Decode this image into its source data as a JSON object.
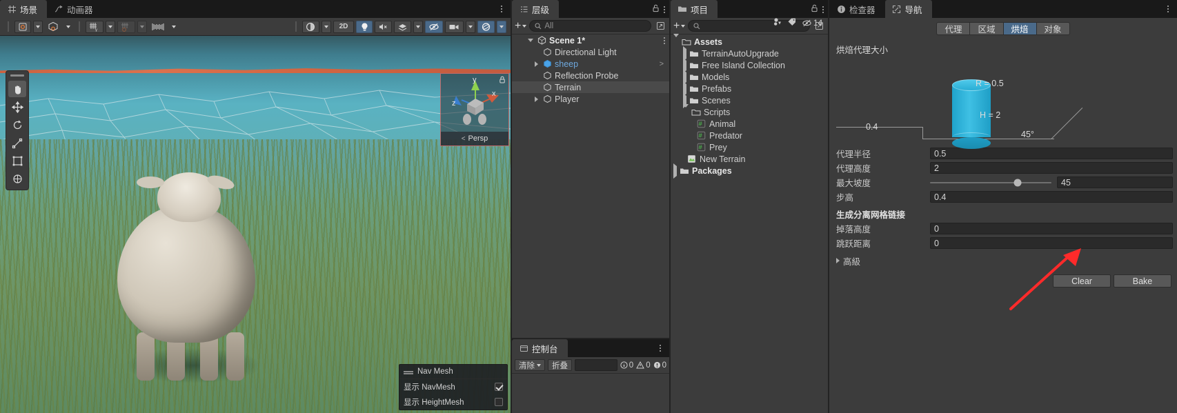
{
  "scene": {
    "tabs": [
      {
        "label": "场景",
        "icon": "grid-icon",
        "active": true
      },
      {
        "label": "动画器",
        "icon": "animator-icon",
        "active": false
      }
    ],
    "toolbar": {
      "left_groups": [
        {
          "name": "pivot-rotation",
          "label": "",
          "icon": "pivot-icon",
          "has_caret": true
        },
        {
          "name": "pivot-center",
          "label": "",
          "icon": "cube-icon",
          "has_caret": true
        },
        {
          "name": "grid-snap",
          "label": "",
          "icon": "grid-snap-icon",
          "has_caret": true
        },
        {
          "name": "vertex-snap",
          "label": "",
          "icon": "vertex-snap-icon",
          "has_caret": true
        },
        {
          "name": "ruler",
          "label": "",
          "icon": "ruler-icon",
          "has_caret": true
        }
      ],
      "right_groups": [
        {
          "name": "shading-mode",
          "label": "",
          "icon": "shading-sphere-icon",
          "has_caret": true
        },
        {
          "name": "2d-toggle",
          "label": "2D",
          "icon": "",
          "has_caret": false
        },
        {
          "name": "lighting-toggle",
          "label": "",
          "icon": "bulb-icon",
          "active": true
        },
        {
          "name": "audio-toggle",
          "label": "",
          "icon": "speaker-mute-icon"
        },
        {
          "name": "effects-toggle",
          "label": "",
          "icon": "fx-icon",
          "has_caret": true
        },
        {
          "name": "visibility-toggle",
          "label": "",
          "icon": "eye-slash-icon",
          "active": true
        },
        {
          "name": "camera-settings",
          "label": "",
          "icon": "camera-icon",
          "has_caret": true
        },
        {
          "name": "gizmos-toggle",
          "label": "",
          "icon": "gizmo-icon",
          "active": true,
          "has_caret": true
        }
      ]
    },
    "tools": [
      {
        "name": "hand-tool",
        "icon": "hand-icon",
        "active": true
      },
      {
        "name": "move-tool",
        "icon": "move-icon",
        "active": false
      },
      {
        "name": "rotate-tool",
        "icon": "rotate-icon",
        "active": false
      },
      {
        "name": "scale-tool",
        "icon": "scale-icon",
        "active": false
      },
      {
        "name": "rect-tool",
        "icon": "rect-icon",
        "active": false
      },
      {
        "name": "transform-tool",
        "icon": "transform-icon",
        "active": false
      }
    ],
    "gizmo": {
      "axis_y": "y",
      "axis_x": "x",
      "axis_z": "z",
      "projection": "Persp"
    },
    "overlay": {
      "title": "Nav Mesh",
      "rows": [
        {
          "label": "显示 NavMesh",
          "checked": true
        },
        {
          "label": "显示 HeightMesh",
          "checked": false
        }
      ]
    }
  },
  "hierarchy": {
    "tab": {
      "label": "层级",
      "icon": "hierarchy-icon"
    },
    "add_label": "+",
    "search_placeholder": "All",
    "items": [
      {
        "label": "Scene 1*",
        "indent": 0,
        "expanded": true,
        "icon": "scene-icon",
        "bold": true,
        "kebab": true
      },
      {
        "label": "Directional Light",
        "indent": 1,
        "icon": "gameobject-icon"
      },
      {
        "label": "sheep",
        "indent": 1,
        "collapsed": true,
        "icon": "prefab-icon",
        "prefab": true,
        "chevron": true
      },
      {
        "label": "Reflection Probe",
        "indent": 1,
        "icon": "gameobject-icon"
      },
      {
        "label": "Terrain",
        "indent": 1,
        "icon": "gameobject-icon",
        "selected": true
      },
      {
        "label": "Player",
        "indent": 1,
        "collapsed": true,
        "icon": "gameobject-icon"
      }
    ]
  },
  "project": {
    "tab": {
      "label": "项目",
      "icon": "folder-icon"
    },
    "add_label": "+",
    "search_placeholder": "",
    "badge_count": "14",
    "items": [
      {
        "label": "Assets",
        "indent": 0,
        "expanded": true,
        "icon": "folder-open-icon",
        "bold": true
      },
      {
        "label": "TerrainAutoUpgrade",
        "indent": 1,
        "collapsed": true,
        "icon": "folder-icon"
      },
      {
        "label": "Free Island Collection",
        "indent": 1,
        "collapsed": true,
        "icon": "folder-icon"
      },
      {
        "label": "Models",
        "indent": 1,
        "collapsed": true,
        "icon": "folder-icon"
      },
      {
        "label": "Prefabs",
        "indent": 1,
        "collapsed": true,
        "icon": "folder-icon"
      },
      {
        "label": "Scenes",
        "indent": 1,
        "collapsed": true,
        "icon": "folder-icon"
      },
      {
        "label": "Scripts",
        "indent": 1,
        "expanded": true,
        "icon": "folder-open-icon"
      },
      {
        "label": "Animal",
        "indent": 2,
        "icon": "script-icon"
      },
      {
        "label": "Predator",
        "indent": 2,
        "icon": "script-icon"
      },
      {
        "label": "Prey",
        "indent": 2,
        "icon": "script-icon"
      },
      {
        "label": "New Terrain",
        "indent": 1,
        "icon": "terrain-asset-icon"
      },
      {
        "label": "Packages",
        "indent": 0,
        "collapsed": true,
        "icon": "folder-icon",
        "bold": true
      }
    ]
  },
  "inspector": {
    "tabs": [
      {
        "label": "检查器",
        "icon": "info-icon",
        "active": false
      },
      {
        "label": "导航",
        "icon": "navigation-icon",
        "active": true
      }
    ],
    "subtabs": [
      {
        "label": "代理",
        "active": false
      },
      {
        "label": "区域",
        "active": false
      },
      {
        "label": "烘焙",
        "active": true
      },
      {
        "label": "对象",
        "active": false
      }
    ],
    "navigation": {
      "section_title": "烘焙代理大小",
      "diagram": {
        "radius_label": "R = 0.5",
        "height_label": "H = 2",
        "step_label": "0.4",
        "slope_label": "45°"
      },
      "fields": [
        {
          "label": "代理半径",
          "value": "0.5",
          "type": "text"
        },
        {
          "label": "代理高度",
          "value": "2",
          "type": "text"
        },
        {
          "label": "最大坡度",
          "value": "45",
          "type": "slider",
          "slider_pct": 72
        },
        {
          "label": "步高",
          "value": "0.4",
          "type": "text"
        }
      ],
      "group_title": "生成分离网格链接",
      "group_fields": [
        {
          "label": "掉落高度",
          "value": "0",
          "type": "text"
        },
        {
          "label": "跳跃距离",
          "value": "0",
          "type": "text"
        }
      ],
      "foldout_label": "高級",
      "buttons": [
        {
          "label": "Clear",
          "name": "clear-button"
        },
        {
          "label": "Bake",
          "name": "bake-button"
        }
      ]
    }
  },
  "console": {
    "tab": {
      "label": "控制台",
      "icon": "console-icon"
    },
    "clear_label": "清除",
    "collapse_label": "折叠",
    "counters": [
      {
        "icon": "log-icon",
        "value": "0"
      },
      {
        "icon": "warning-icon",
        "value": "0"
      },
      {
        "icon": "error-icon",
        "value": "0"
      }
    ]
  },
  "colors": {
    "accent_blue": "#4a6a8a",
    "panel_bg": "#3c3c3c",
    "window_bg": "#383838",
    "strip_bg": "#191919",
    "cylinder": "#2eb0d8",
    "arrow_red": "#ff2a2a",
    "prefab_blue": "#6ea8dd"
  }
}
